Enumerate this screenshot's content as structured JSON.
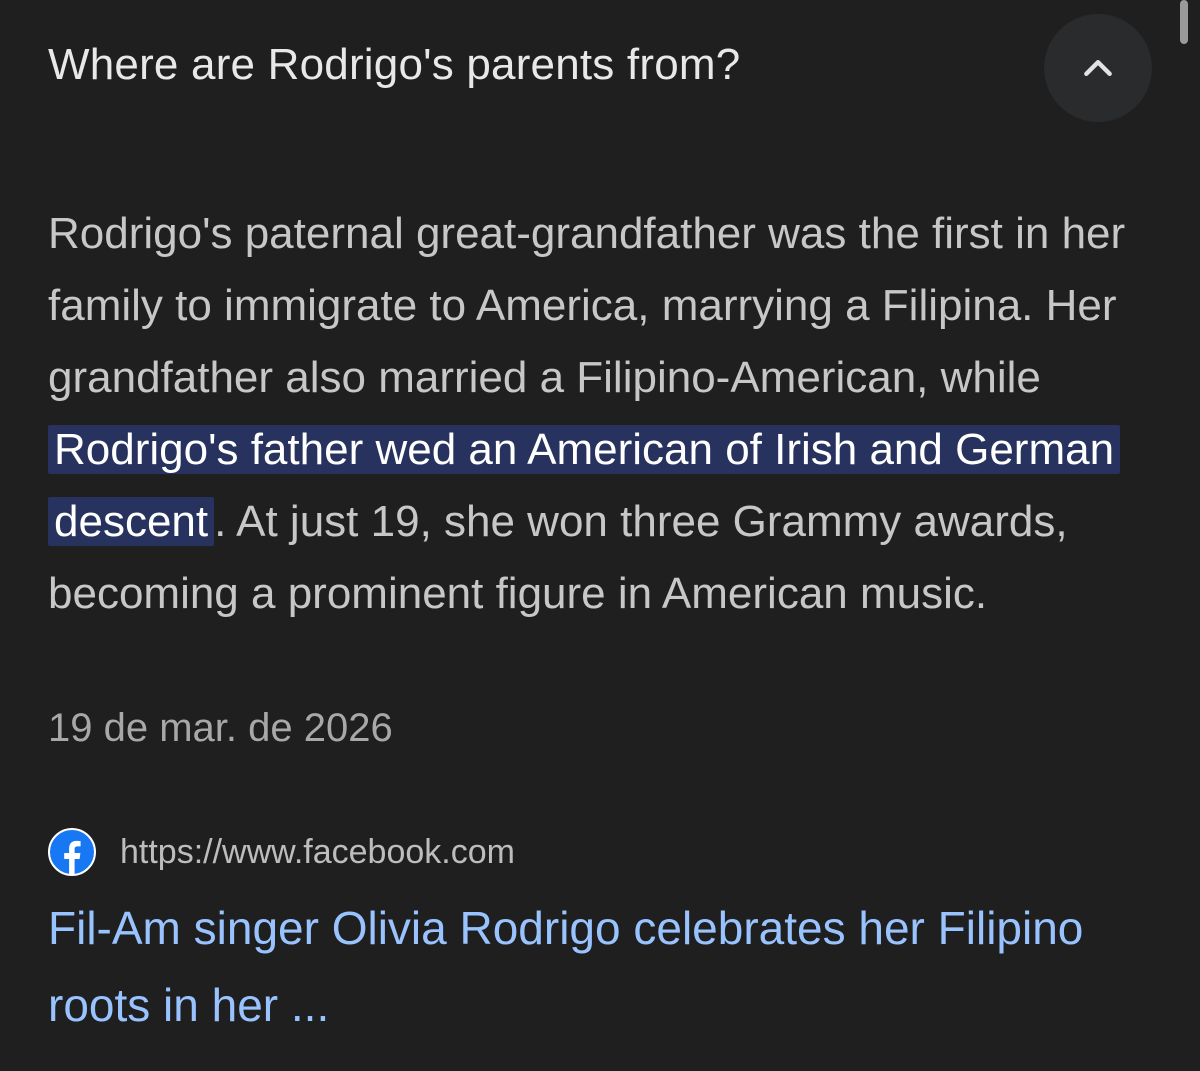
{
  "faq": {
    "question": "Where are Rodrigo's parents from?",
    "collapse_icon": "chevron-up-icon"
  },
  "answer": {
    "text_before": "Rodrigo's paternal great-grandfather was the first in her family to immigrate to America, marrying a Filipina. Her grandfather also married a Filipino-American, while ",
    "highlight": "Rodrigo's father wed an American of Irish and German descent",
    "text_after": ". At just 19, she won three Grammy awards, becoming a prominent figure in American music.",
    "date": "19 de mar. de 2026"
  },
  "source": {
    "icon": "facebook-icon",
    "url": "https://www.facebook.com",
    "link_title": "Fil-Am singer Olivia Rodrigo celebrates her Filipino roots in her ..."
  },
  "colors": {
    "background": "#1f1f1f",
    "highlight_bg": "#27335e",
    "link": "#99c3ff",
    "facebook_blue": "#1877f2"
  }
}
